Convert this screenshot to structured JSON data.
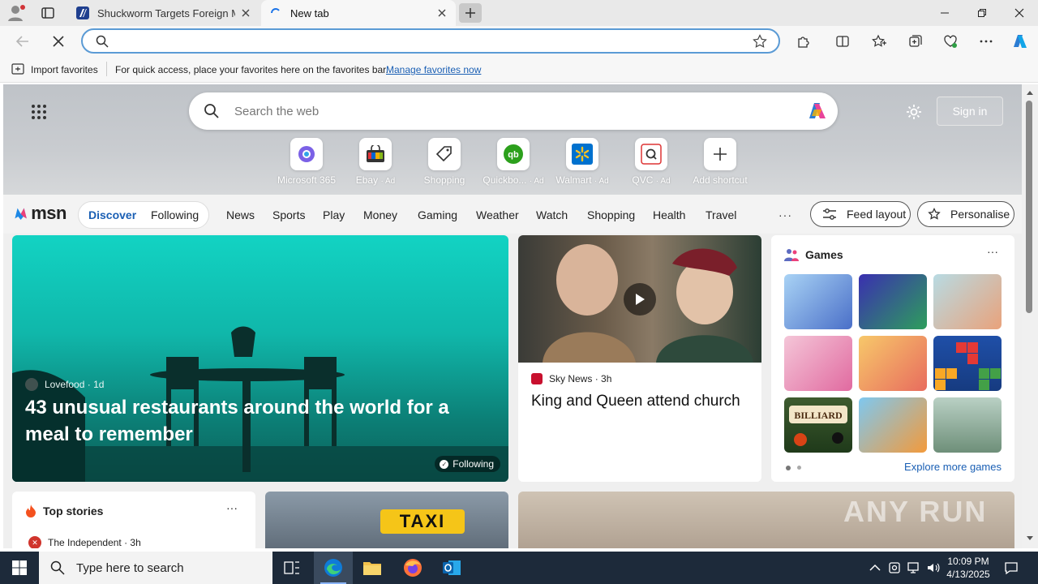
{
  "tabs": [
    {
      "title": "Shuckworm Targets Foreign Milit",
      "active": false
    },
    {
      "title": "New tab",
      "active": true
    }
  ],
  "favorites_bar": {
    "import_label": "Import favorites",
    "hint": "For quick access, place your favorites here on the favorites bar.",
    "manage_link": "Manage favorites now"
  },
  "newtab": {
    "search_placeholder": "Search the web",
    "sign_in": "Sign in",
    "shortcuts": [
      {
        "label": "Microsoft 365",
        "ad": ""
      },
      {
        "label": "Ebay",
        "ad": "· Ad"
      },
      {
        "label": "Shopping",
        "ad": ""
      },
      {
        "label": "Quickbo...",
        "ad": "· Ad"
      },
      {
        "label": "Walmart",
        "ad": "· Ad"
      },
      {
        "label": "QVC",
        "ad": "· Ad"
      },
      {
        "label": "Add shortcut",
        "ad": ""
      }
    ]
  },
  "msn": {
    "logo": "msn",
    "discover": "Discover",
    "following": "Following",
    "nav": [
      "News",
      "Sports",
      "Play",
      "Money",
      "Gaming",
      "Weather",
      "Watch",
      "Shopping",
      "Health",
      "Travel"
    ],
    "more": "···",
    "feed_layout": "Feed layout",
    "personalise": "Personalise"
  },
  "hero": {
    "source": "Lovefood",
    "age": "· 1d",
    "title": "43 unusual restaurants around the world for a meal to remember",
    "following": "Following"
  },
  "news": {
    "source": "Sky News",
    "age": "· 3h",
    "title": "King and Queen attend church"
  },
  "games": {
    "title": "Games",
    "more": "···",
    "explore": "Explore more games"
  },
  "top_stories": {
    "title": "Top stories",
    "more": "···",
    "source": "The Independent",
    "age": "· 3h"
  },
  "taxi_sign": "TAXI",
  "watermark": "ANY RUN",
  "taskbar": {
    "search_placeholder": "Type here to search",
    "time": "10:09 PM",
    "date": "4/13/2025"
  }
}
